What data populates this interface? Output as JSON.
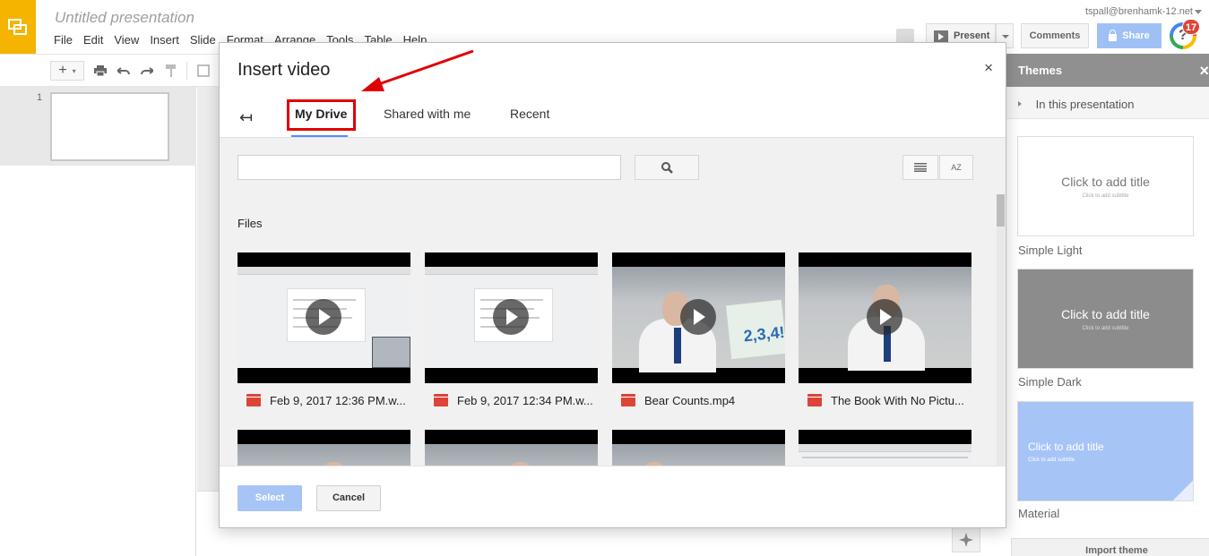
{
  "app": {
    "doc_title": "Untitled presentation",
    "account": "tspall@brenhamk-12.net",
    "menu": [
      "File",
      "Edit",
      "View",
      "Insert",
      "Slide",
      "Format",
      "Arrange",
      "Tools",
      "Table",
      "Help"
    ],
    "present_label": "Present",
    "comments_label": "Comments",
    "share_label": "Share",
    "notification_count": "17",
    "notification_glyph": "?",
    "icons": [
      "slides-logo-icon",
      "add-icon",
      "print-icon",
      "undo-icon",
      "redo-icon",
      "paint-format-icon",
      "present-play-icon",
      "lock-icon",
      "explore-icon"
    ],
    "colors": {
      "brand": "#f4b400",
      "accent": "#4d90fe",
      "share": "#9fc0f5",
      "highlight": "#e00000"
    }
  },
  "filmstrip": {
    "slide_number": "1"
  },
  "themes": {
    "header": "Themes",
    "close": "×",
    "section_label": "In this presentation",
    "cards": [
      {
        "name": "Simple Light",
        "title": "Click to add title",
        "subtitle": "Click to add subtitle"
      },
      {
        "name": "Simple Dark",
        "title": "Click to add title",
        "subtitle": "Click to add subtitle"
      },
      {
        "name": "Material",
        "title": "Click to add title",
        "subtitle": "Click to add subtitle"
      }
    ],
    "import_label": "Import theme"
  },
  "dialog": {
    "title": "Insert video",
    "close": "×",
    "back": "↤",
    "tabs": [
      {
        "label": "My Drive",
        "active": true
      },
      {
        "label": "Shared with me",
        "active": false
      },
      {
        "label": "Recent",
        "active": false
      }
    ],
    "search": {
      "value": "",
      "placeholder": ""
    },
    "sort_label": "AZ",
    "files_label": "Files",
    "files": [
      {
        "name": "Feb 9, 2017 12:36 PM.w...",
        "kind": "screen-recording",
        "icon": "video-file-icon"
      },
      {
        "name": "Feb 9, 2017 12:34 PM.w...",
        "kind": "screen-recording",
        "icon": "video-file-icon"
      },
      {
        "name": "Bear Counts.mp4",
        "kind": "camera",
        "icon": "video-file-icon"
      },
      {
        "name": "The Book With No Pictu...",
        "kind": "camera",
        "icon": "video-file-icon"
      }
    ],
    "select_label": "Select",
    "cancel_label": "Cancel"
  }
}
